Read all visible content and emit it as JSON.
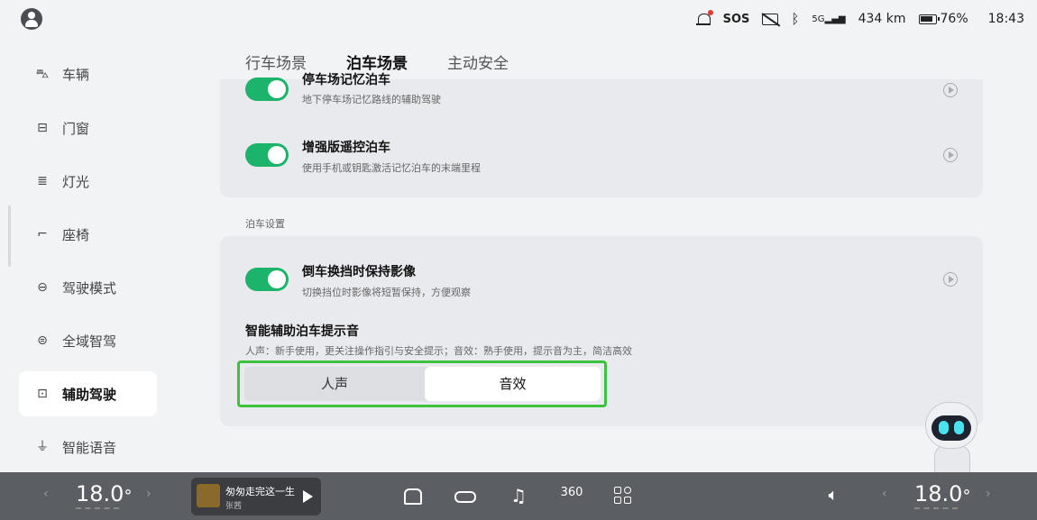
{
  "status_bar": {
    "sos": "SOS",
    "signal": "5G",
    "range": "434 km",
    "battery": "76%",
    "time": "18:43"
  },
  "sidebar": {
    "items": [
      {
        "label": "车辆",
        "icon": "car-outline-icon"
      },
      {
        "label": "门窗",
        "icon": "door-icon"
      },
      {
        "label": "灯光",
        "icon": "headlight-icon"
      },
      {
        "label": "座椅",
        "icon": "seat-icon"
      },
      {
        "label": "驾驶模式",
        "icon": "drive-mode-icon"
      },
      {
        "label": "全域智驾",
        "icon": "smart-drive-icon"
      },
      {
        "label": "辅助驾驶",
        "icon": "assist-drive-icon",
        "active": true
      },
      {
        "label": "智能语音",
        "icon": "microphone-icon"
      }
    ]
  },
  "tabs": [
    {
      "label": "行车场景"
    },
    {
      "label": "泊车场景",
      "active": true
    },
    {
      "label": "主动安全"
    }
  ],
  "card1": {
    "row1": {
      "title": "停车场记忆泊车",
      "desc": "地下停车场记忆路线的辅助驾驶",
      "enabled": true
    },
    "row2": {
      "title": "增强版遥控泊车",
      "desc": "使用手机或钥匙激活记忆泊车的末端里程",
      "enabled": true
    }
  },
  "section_label": "泊车设置",
  "card2": {
    "row1": {
      "title": "倒车换挡时保持影像",
      "desc": "切换挡位时影像将短暂保持，方便观察",
      "enabled": true
    },
    "sound": {
      "title": "智能辅助泊车提示音",
      "desc": "人声：新手使用，更关注操作指引与安全提示；音效：熟手使用，提示音为主，简洁高效",
      "options": [
        "人声",
        "音效"
      ],
      "selected": "音效"
    }
  },
  "dock": {
    "temp_left": "18.0",
    "temp_right": "18.0",
    "temp_unit": "°",
    "song": "匆匆走完这一生",
    "artist": "张茜",
    "view360": "360"
  },
  "colors": {
    "accent": "#1cb36a",
    "highlight_frame": "#3cc23c"
  }
}
